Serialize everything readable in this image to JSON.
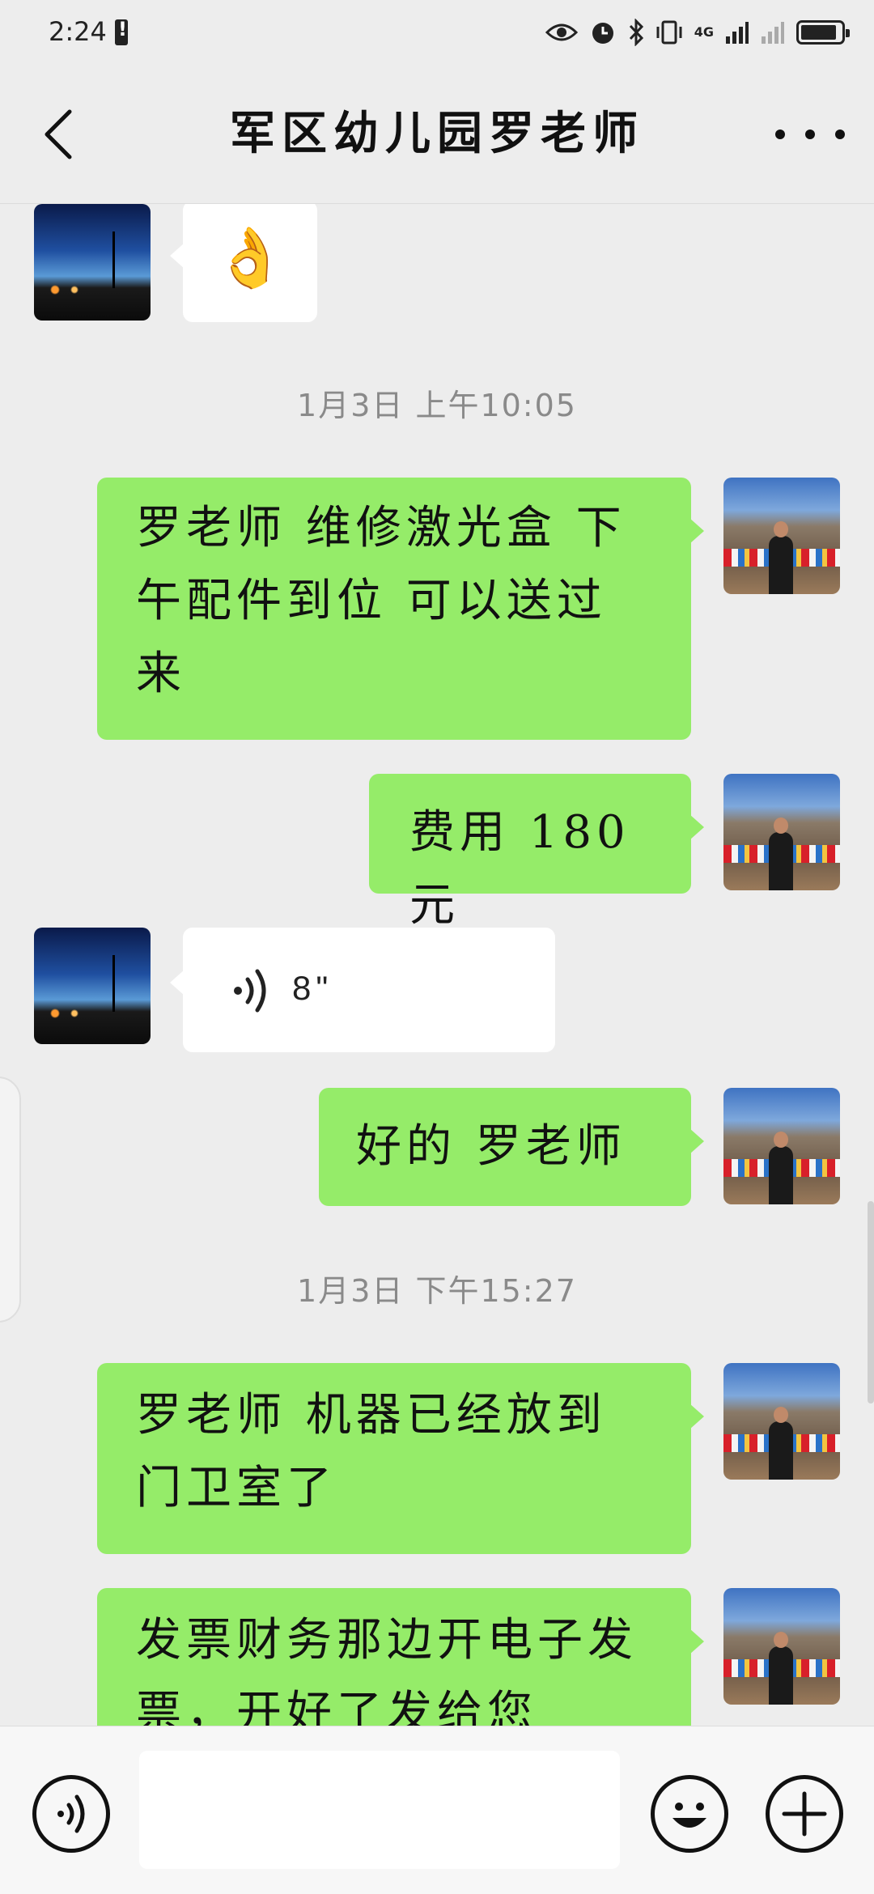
{
  "status_bar": {
    "time": "2:24",
    "network_label": "4G",
    "icons": [
      "eye-icon",
      "alarm-icon",
      "bluetooth-icon",
      "vibrate-icon",
      "signal-icon",
      "signal-weak-icon",
      "battery-icon"
    ]
  },
  "header": {
    "title": "军区幼儿园罗老师",
    "back_icon": "chevron-left-icon",
    "more_icon": "more-dots-icon"
  },
  "messages": [
    {
      "from": "contact",
      "type": "emoji",
      "content": "👌",
      "avatar": "night-sky-avatar"
    },
    {
      "type": "timestamp",
      "text": "1月3日  上午10:05"
    },
    {
      "from": "me",
      "type": "text",
      "lines": [
        "罗老师 维修激光盒 下",
        "午配件到位 可以送过",
        "来"
      ],
      "avatar": "mountain-avatar"
    },
    {
      "from": "me",
      "type": "text",
      "lines": [
        "费用 180 元"
      ],
      "avatar": "mountain-avatar"
    },
    {
      "from": "contact",
      "type": "voice",
      "duration": "8\"",
      "avatar": "night-sky-avatar"
    },
    {
      "from": "me",
      "type": "text",
      "lines": [
        "好的 罗老师"
      ],
      "avatar": "mountain-avatar"
    },
    {
      "type": "timestamp",
      "text": "1月3日  下午15:27"
    },
    {
      "from": "me",
      "type": "text",
      "lines": [
        "罗老师 机器已经放到",
        "门卫室了"
      ],
      "avatar": "mountain-avatar"
    },
    {
      "from": "me",
      "type": "text",
      "lines": [
        "发票财务那边开电子发",
        "票，开好了发给您"
      ],
      "avatar": "mountain-avatar"
    }
  ],
  "input_bar": {
    "voice_icon": "voice-input-icon",
    "emoji_icon": "emoji-icon",
    "plus_icon": "plus-icon",
    "text_value": ""
  },
  "colors": {
    "background": "#ededed",
    "sent_bubble": "#95ec69",
    "received_bubble": "#ffffff",
    "timestamp_text": "#8a8a8a"
  }
}
